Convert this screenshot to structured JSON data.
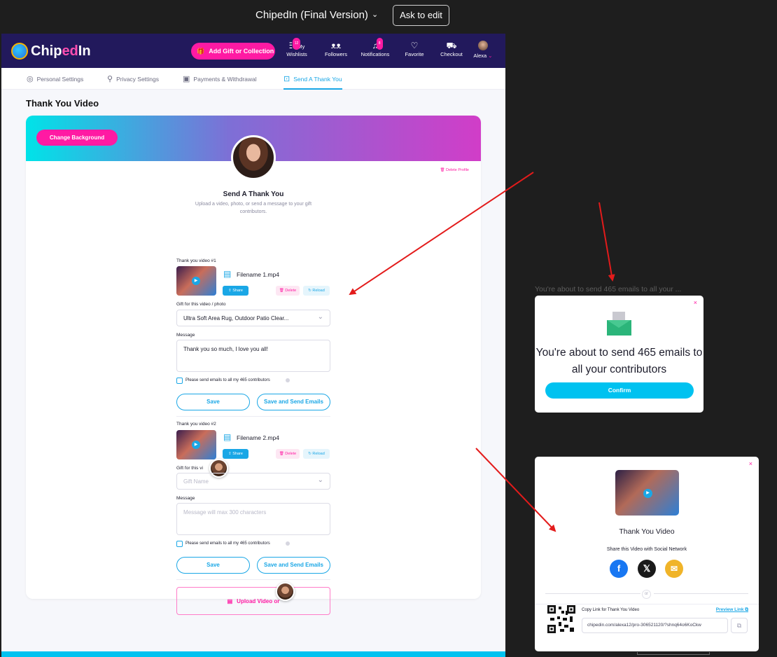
{
  "toolbar": {
    "title": "ChipedIn (Final Version)",
    "ask_label": "Ask to edit"
  },
  "nav": {
    "logo_a": "Chip",
    "logo_b": "ed",
    "logo_c": "In",
    "add_label": "Add Gift or Collection",
    "items": [
      {
        "label": "My Wishlists",
        "badge": "12"
      },
      {
        "label": "Followers"
      },
      {
        "label": "Notifications",
        "badge": "8"
      },
      {
        "label": "Favorite"
      },
      {
        "label": "Checkout"
      },
      {
        "label": "Alexa"
      }
    ]
  },
  "tabs": [
    {
      "label": "Personal Settings"
    },
    {
      "label": "Privacy Settings"
    },
    {
      "label": "Payments & Withdrawal"
    },
    {
      "label": "Send A Thank You"
    }
  ],
  "page": {
    "title": "Thank You Video",
    "change_bg": "Change Background",
    "delete_profile": "Delete Profile",
    "send_title": "Send A Thank You",
    "send_sub": "Upload a video, photo, or send a message to your gift contributors.",
    "video1": {
      "label": "Thank you video #1",
      "filename": "Filename 1.mp4",
      "share": "Share",
      "delete": "Delete",
      "reload": "Reload",
      "gift_label": "Gift for this video / photo",
      "gift_value": "Ultra Soft Area Rug, Outdoor Patio Clear...",
      "msg_label": "Message",
      "msg_value": "Thank you so much, I love you all!",
      "chk_label": "Please send emails to all my 465 contributors",
      "save": "Save",
      "save_send": "Save and Send Emails"
    },
    "video2": {
      "label": "Thank you video #2",
      "filename": "Filename 2.mp4",
      "share": "Share",
      "delete": "Delete",
      "reload": "Reload",
      "gift_label": "Gift for this vi",
      "gift_placeholder": "Gift Name",
      "msg_label": "Message",
      "msg_placeholder": "Message will max 300 characters",
      "chk_label": "Please send emails to all my 465 contributors",
      "save": "Save",
      "save_send": "Save and Send Emails"
    },
    "upload_label": "Upload Video or"
  },
  "ghost_text": "You're about to send 465 emails to all your ...",
  "confirm_modal": {
    "text": "You're about to send 465 emails to all your contributors",
    "confirm": "Confirm",
    "close": "×"
  },
  "share_modal": {
    "title": "Thank You Video",
    "sub": "Share this Video with Social Network",
    "or": "or",
    "copy_label": "Copy Link for Thank You Video",
    "preview": "Preview Link",
    "link": "chipedin.com/alexa12/pro-306521120/?shnq64o6KoCkw",
    "close": "×"
  },
  "colors": {
    "brand_pink": "#ff1aa3",
    "brand_blue": "#1aa7e6",
    "nav_bg": "#22195c",
    "arrow": "#e31b1b"
  }
}
